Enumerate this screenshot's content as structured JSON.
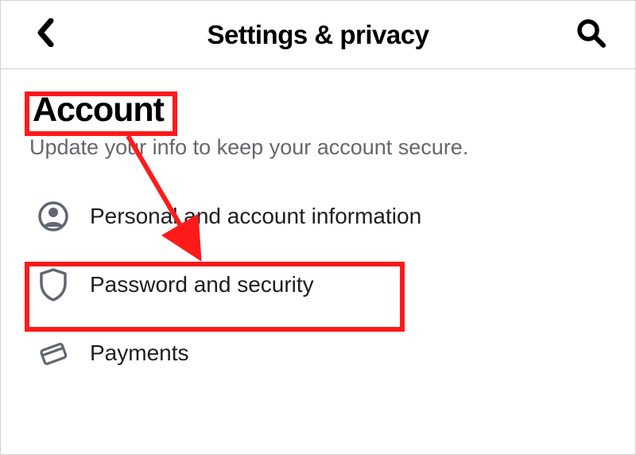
{
  "header": {
    "title": "Settings & privacy"
  },
  "section": {
    "title": "Account",
    "subtitle": "Update your info to keep your account secure.",
    "items": [
      {
        "label": "Personal and account information"
      },
      {
        "label": "Password and security"
      },
      {
        "label": "Payments"
      }
    ]
  }
}
